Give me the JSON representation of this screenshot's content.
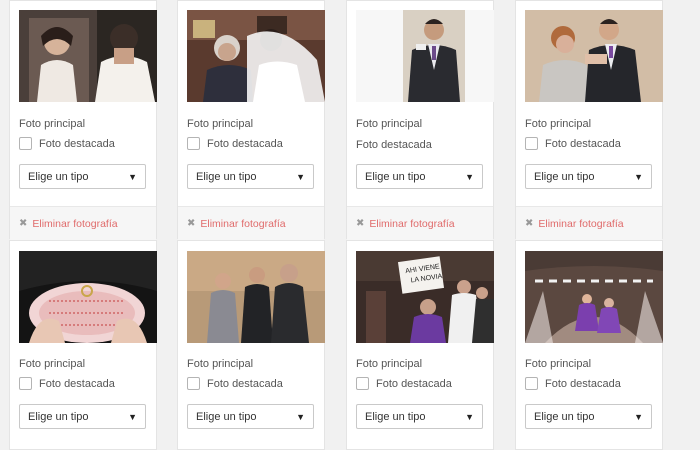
{
  "cards": [
    {
      "principal_label": "Foto principal",
      "destacada_label": "Foto destacada",
      "select_value": "Elige un tipo",
      "delete_label": "Eliminar fotografía",
      "photo": "bride-mirror-photo"
    },
    {
      "principal_label": "Foto principal",
      "destacada_label": "Foto destacada",
      "select_value": "Elige un tipo",
      "delete_label": "Eliminar fotografía",
      "photo": "bride-hug-photo"
    },
    {
      "principal_label": "Foto principal",
      "destacada_label": "Foto destacada",
      "select_value": "Elige un tipo",
      "delete_label": "Eliminar fotografía",
      "photo": "groom-portrait-photo"
    },
    {
      "principal_label": "Foto principal",
      "destacada_label": "Foto destacada",
      "select_value": "Elige un tipo",
      "delete_label": "Eliminar fotografía",
      "photo": "groom-boutonniere-photo"
    },
    {
      "principal_label": "Foto principal",
      "destacada_label": "Foto destacada",
      "select_value": "Elige un tipo",
      "photo": "ring-pillow-photo"
    },
    {
      "principal_label": "Foto principal",
      "destacada_label": "Foto destacada",
      "select_value": "Elige un tipo",
      "photo": "family-group-photo"
    },
    {
      "principal_label": "Foto principal",
      "destacada_label": "Foto destacada",
      "select_value": "Elige un tipo",
      "photo": "church-sign-photo",
      "sign_text": "AHI VIENE LA NOVIA"
    },
    {
      "principal_label": "Foto principal",
      "destacada_label": "Foto destacada",
      "select_value": "Elige un tipo",
      "photo": "church-aisle-photo"
    }
  ],
  "colors": {
    "delete_text": "#e06b6b",
    "card_border": "#e4e4e4",
    "background": "#f1f1f1"
  },
  "icons": {
    "delete": "x-icon",
    "select": "caret-down-icon",
    "checkbox": "checkbox-icon"
  }
}
